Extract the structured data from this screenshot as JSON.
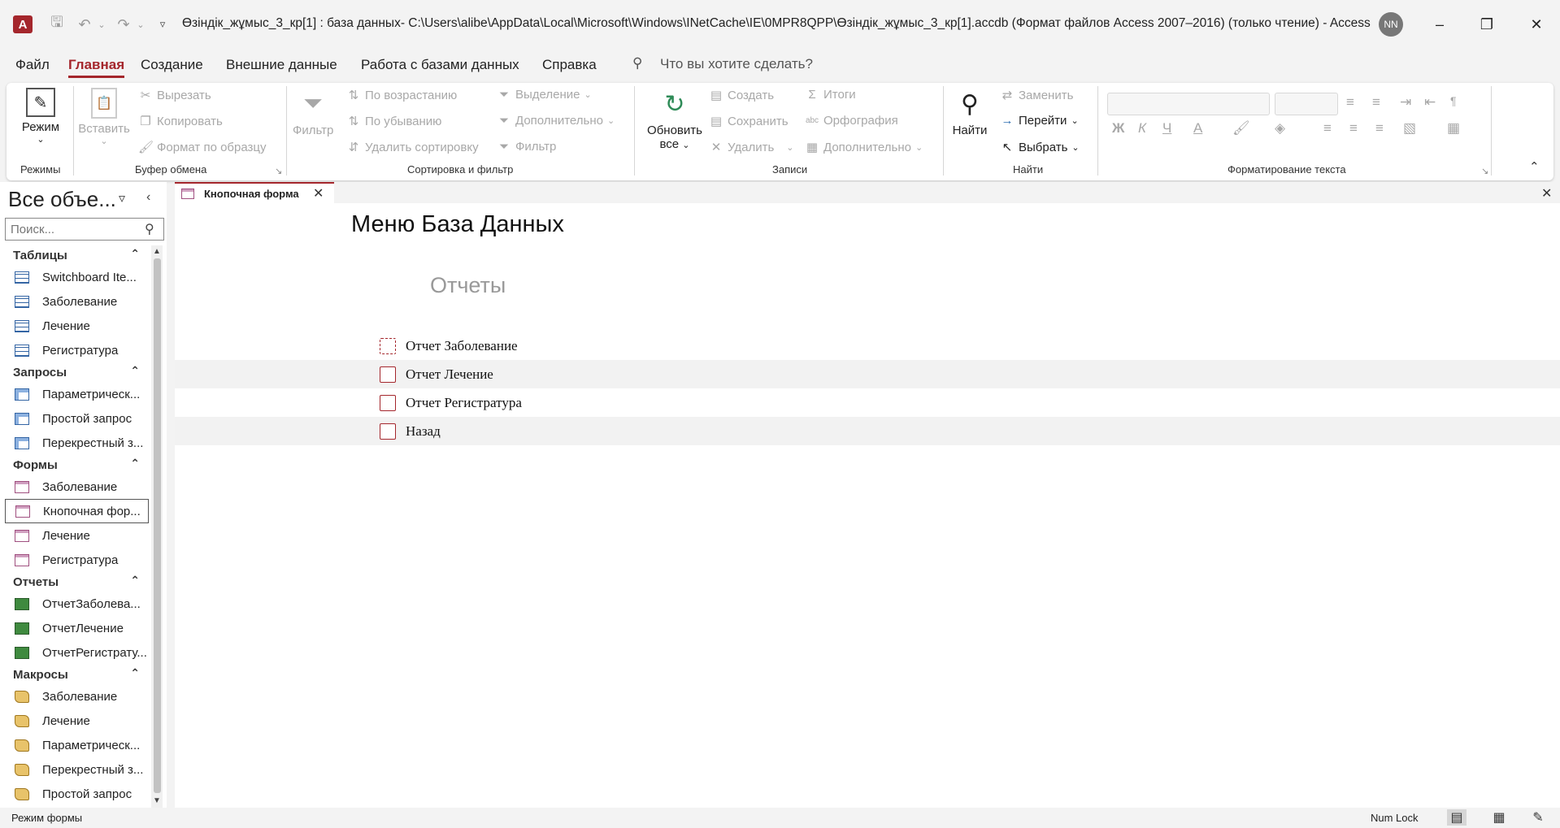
{
  "app": {
    "icon_letter": "A",
    "title": "Өзіндік_жұмыс_3_кр[1] : база данных- C:\\Users\\alibe\\AppData\\Local\\Microsoft\\Windows\\INetCache\\IE\\0MPR8QPP\\Өзіндік_жұмыс_3_кр[1].accdb (Формат файлов Access 2007–2016) (только чтение)  -  Access",
    "user_initials": "NN"
  },
  "menu": {
    "tabs": [
      "Файл",
      "Главная",
      "Создание",
      "Внешние данные",
      "Работа с базами данных",
      "Справка"
    ],
    "tell_me": "Что вы хотите сделать?"
  },
  "ribbon": {
    "modes": {
      "label": "Режимы",
      "view": "Режим"
    },
    "clipboard": {
      "label": "Буфер обмена",
      "paste": "Вставить",
      "cut": "Вырезать",
      "copy": "Копировать",
      "format_painter": "Формат по образцу"
    },
    "sort_filter": {
      "label": "Сортировка и фильтр",
      "filter": "Фильтр",
      "ascending": "По возрастанию",
      "descending": "По убыванию",
      "remove_sort": "Удалить сортировку",
      "selection": "Выделение",
      "advanced": "Дополнительно",
      "toggle_filter": "Фильтр"
    },
    "records": {
      "label": "Записи",
      "refresh_line1": "Обновить",
      "refresh_line2": "все",
      "new": "Создать",
      "save": "Сохранить",
      "delete": "Удалить",
      "totals": "Итоги",
      "spelling": "Орфография",
      "more": "Дополнительно"
    },
    "find": {
      "label": "Найти",
      "find": "Найти",
      "replace": "Заменить",
      "goto": "Перейти",
      "select": "Выбрать"
    },
    "text_format": {
      "label": "Форматирование текста",
      "bold": "Ж",
      "italic": "К",
      "underline": "Ч",
      "font_color": "A"
    }
  },
  "nav": {
    "title": "Все объе...",
    "search_placeholder": "Поиск...",
    "categories": [
      {
        "name": "Таблицы",
        "type": "table",
        "items": [
          "Switchboard Ite...",
          "Заболевание",
          "Лечение",
          "Регистратура"
        ]
      },
      {
        "name": "Запросы",
        "type": "query",
        "items": [
          "Параметрическ...",
          "Простой запрос",
          "Перекрестный з..."
        ]
      },
      {
        "name": "Формы",
        "type": "form",
        "items": [
          "Заболевание",
          "Кнопочная фор...",
          "Лечение",
          "Регистратура"
        ]
      },
      {
        "name": "Отчеты",
        "type": "report",
        "items": [
          "ОтчетЗаболева...",
          "ОтчетЛечение",
          "ОтчетРегистрату..."
        ]
      },
      {
        "name": "Макросы",
        "type": "macro",
        "items": [
          "Заболевание",
          "Лечение",
          "Параметрическ...",
          "Перекрестный з...",
          "Простой запрос"
        ]
      }
    ]
  },
  "document": {
    "tab_label": "Кнопочная форма",
    "form_title": "Меню База Данных",
    "form_subtitle": "Отчеты",
    "buttons": [
      "Отчет Заболевание",
      "Отчет Лечение",
      "Отчет Регистратура",
      "Назад"
    ]
  },
  "status": {
    "mode": "Режим формы",
    "num_lock": "Num Lock"
  }
}
